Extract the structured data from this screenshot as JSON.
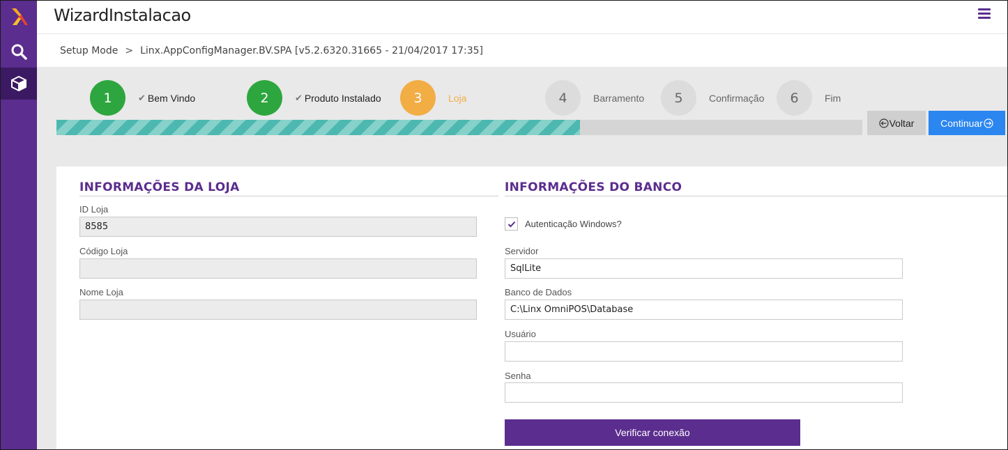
{
  "rail": {
    "logo_icon": "linx-logo-icon",
    "items": [
      {
        "icon": "search-icon"
      },
      {
        "icon": "package-icon"
      }
    ]
  },
  "header": {
    "title": "WizardInstalacao",
    "menu_icon": "hamburger-menu-icon"
  },
  "breadcrumb": {
    "root": "Setup Mode",
    "separator": ">",
    "current": "Linx.AppConfigManager.BV.SPA [v5.2.6320.31665 - 21/04/2017 17:35]"
  },
  "wizard": {
    "steps": [
      {
        "number": "1",
        "label": "Bem Vindo",
        "state": "done"
      },
      {
        "number": "2",
        "label": "Produto Instalado",
        "state": "done"
      },
      {
        "number": "3",
        "label": "Loja",
        "state": "current"
      },
      {
        "number": "4",
        "label": "Barramento",
        "state": "todo"
      },
      {
        "number": "5",
        "label": "Confirmação",
        "state": "todo"
      },
      {
        "number": "6",
        "label": "Fim",
        "state": "todo"
      }
    ],
    "progress_fraction": 0.65,
    "back_label": "Voltar",
    "next_label": "Continuar"
  },
  "loja": {
    "title": "INFORMAÇÕES DA LOJA",
    "id_label": "ID Loja",
    "id_value": "8585",
    "codigo_label": "Código Loja",
    "codigo_value": "",
    "nome_label": "Nome Loja",
    "nome_value": ""
  },
  "banco": {
    "title": "INFORMAÇÕES DO BANCO",
    "auth_label": "Autenticação Windows?",
    "auth_checked": true,
    "servidor_label": "Servidor",
    "servidor_value": "SqlLite",
    "banco_label": "Banco de Dados",
    "banco_value": "C:\\Linx OmniPOS\\Database",
    "usuario_label": "Usuário",
    "usuario_value": "",
    "senha_label": "Senha",
    "senha_value": "",
    "verify_label": "Verificar conexão"
  },
  "colors": {
    "brand_purple": "#5b2d8e",
    "step_done": "#2ea63f",
    "step_current": "#f2ad45",
    "step_todo": "#dcdcdc",
    "progress_teal": "#4db8b0",
    "primary_blue": "#2b86f0"
  }
}
